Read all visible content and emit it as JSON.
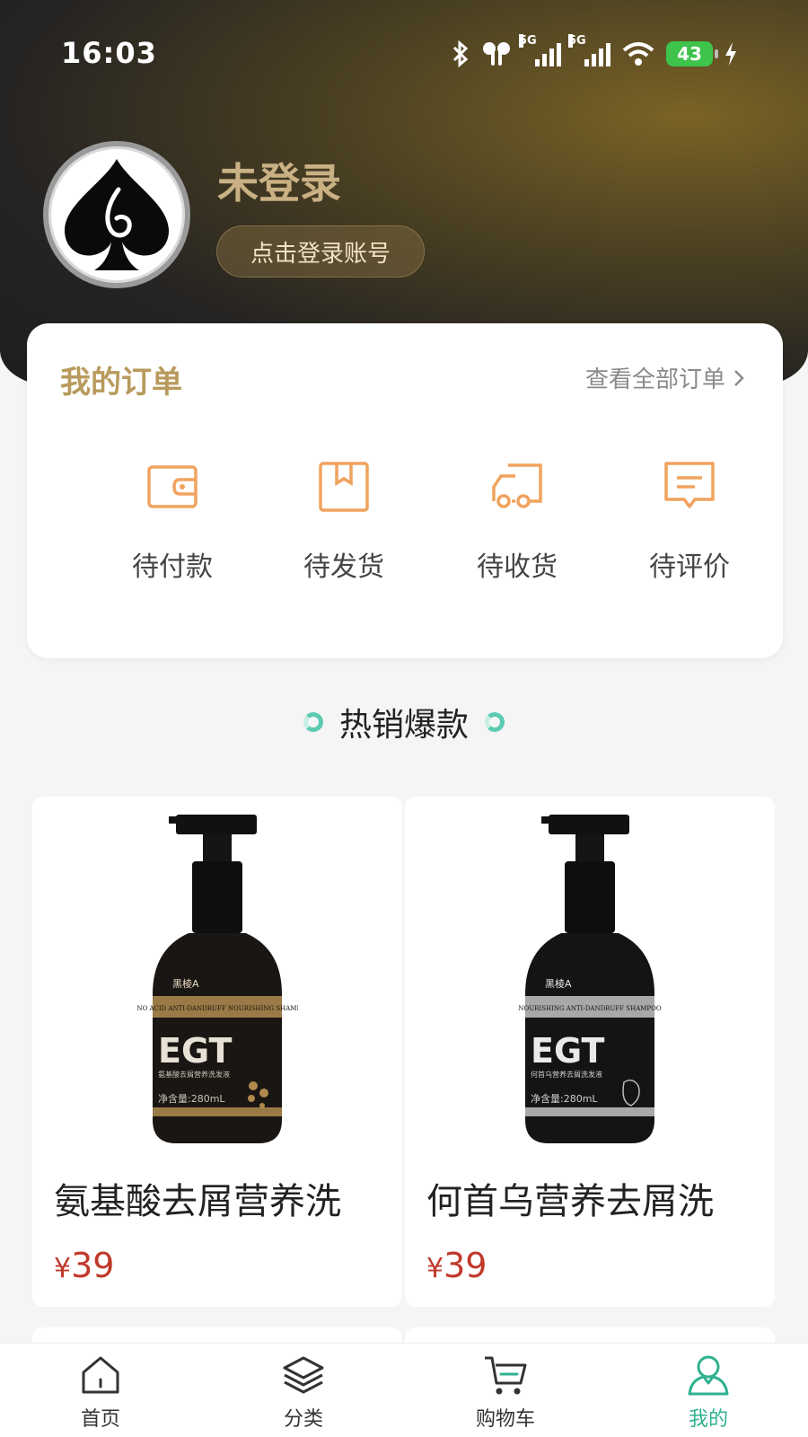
{
  "status_bar": {
    "time": "16:03",
    "signal_1": "5G",
    "signal_2": "5G",
    "battery": "43"
  },
  "profile": {
    "name": "未登录",
    "login_button": "点击登录账号"
  },
  "orders": {
    "title": "我的订单",
    "view_all": "查看全部订单",
    "items": [
      {
        "label": "待付款",
        "icon": "wallet-icon"
      },
      {
        "label": "待发货",
        "icon": "package-icon"
      },
      {
        "label": "待收货",
        "icon": "truck-icon"
      },
      {
        "label": "待评价",
        "icon": "comment-icon"
      }
    ]
  },
  "hot": {
    "title": "热销爆款"
  },
  "products": [
    {
      "name": "氨基酸去屑营养洗",
      "currency": "¥",
      "price": "39",
      "brand": "黑棱A",
      "label_en": "AMINO ACID ANTI-DANDRUFF NOURISHING SHAMPOO",
      "logo": "EGT",
      "label_cn": "氨基酸去屑营养洗发液",
      "volume": "净含量:280mL",
      "accent": "#b08a4c"
    },
    {
      "name": "何首乌营养去屑洗",
      "currency": "¥",
      "price": "39",
      "brand": "黑棱A",
      "label_en": "NOURISHING ANTI-DANDRUFF SHAMPOO",
      "logo": "EGT",
      "label_cn": "何首乌营养去屑洗发液",
      "volume": "净含量:280mL",
      "accent": "#b5b5b5"
    }
  ],
  "tabbar": {
    "items": [
      {
        "label": "首页",
        "icon": "home-icon"
      },
      {
        "label": "分类",
        "icon": "layers-icon"
      },
      {
        "label": "购物车",
        "icon": "cart-icon"
      },
      {
        "label": "我的",
        "icon": "user-icon",
        "active": true
      }
    ]
  },
  "colors": {
    "gold": "#b89a5c",
    "accent_green": "#2fb28f",
    "order_icon": "#f0a35e",
    "price": "#c0392b"
  }
}
